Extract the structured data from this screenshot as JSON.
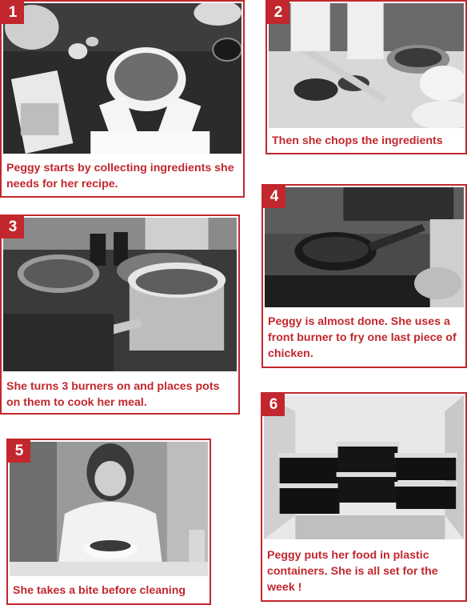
{
  "colors": {
    "accent": "#c1272d",
    "photo_dark": "#2b2b2b",
    "photo_light": "#e6e6e6"
  },
  "panels": [
    {
      "number": "1",
      "caption": "Peggy starts by collecting ingredients she needs for her recipe.",
      "photo": "hands-mixing-bowl-with-recipe-magazine"
    },
    {
      "number": "2",
      "caption": "Then she chops the ingredients",
      "photo": "knife-chopping-herbs-on-board"
    },
    {
      "number": "3",
      "caption": "She turns 3 burners on and places pots on them to cook her meal.",
      "photo": "pots-and-pans-on-stove"
    },
    {
      "number": "4",
      "caption": "Peggy is almost done. She uses a front burner to fry one last piece of chicken.",
      "photo": "frying-pan-on-front-burner"
    },
    {
      "number": "5",
      "caption": "She takes a bite before cleaning",
      "photo": "woman-tasting-food-from-bowl"
    },
    {
      "number": "6",
      "caption": "Peggy puts her food in plastic containers. She is all set for the week !",
      "photo": "stacked-meal-containers-in-fridge"
    }
  ]
}
